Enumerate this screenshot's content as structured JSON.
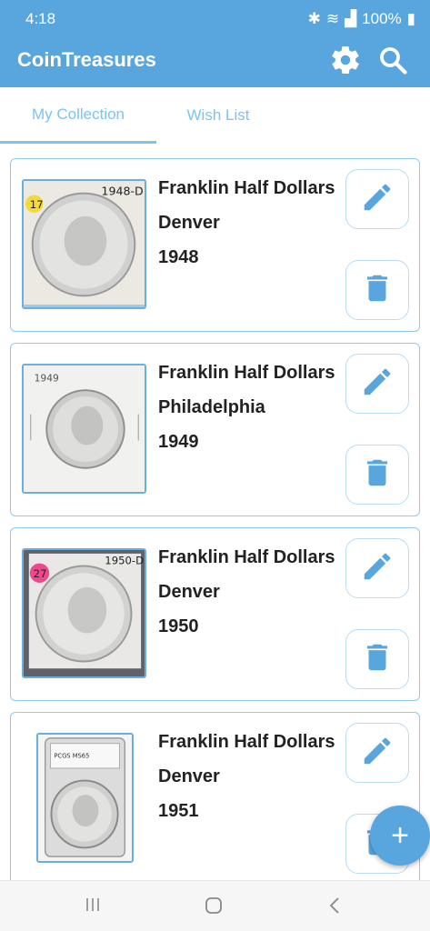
{
  "status": {
    "time": "4:18",
    "battery": "100%"
  },
  "app": {
    "title": "CoinTreasures",
    "accent": "#58a6dd"
  },
  "tabs": [
    {
      "label": "My Collection",
      "active": true
    },
    {
      "label": "Wish List",
      "active": false
    }
  ],
  "coins": [
    {
      "series": "Franklin Half Dollars",
      "mint": "Denver",
      "year": "1948",
      "tag": "17",
      "note": "1948-D"
    },
    {
      "series": "Franklin Half Dollars",
      "mint": "Philadelphia",
      "year": "1949",
      "tag": "",
      "note": "1949"
    },
    {
      "series": "Franklin Half Dollars",
      "mint": "Denver",
      "year": "1950",
      "tag": "27",
      "note": "1950-D"
    },
    {
      "series": "Franklin Half Dollars",
      "mint": "Denver",
      "year": "1951",
      "tag": "",
      "note": "PCGS MS65"
    }
  ],
  "icons": {
    "settings": "gear-icon",
    "search": "search-icon",
    "edit": "pencil-icon",
    "delete": "trash-icon",
    "add": "plus-icon"
  },
  "fab": {
    "label": "+"
  }
}
